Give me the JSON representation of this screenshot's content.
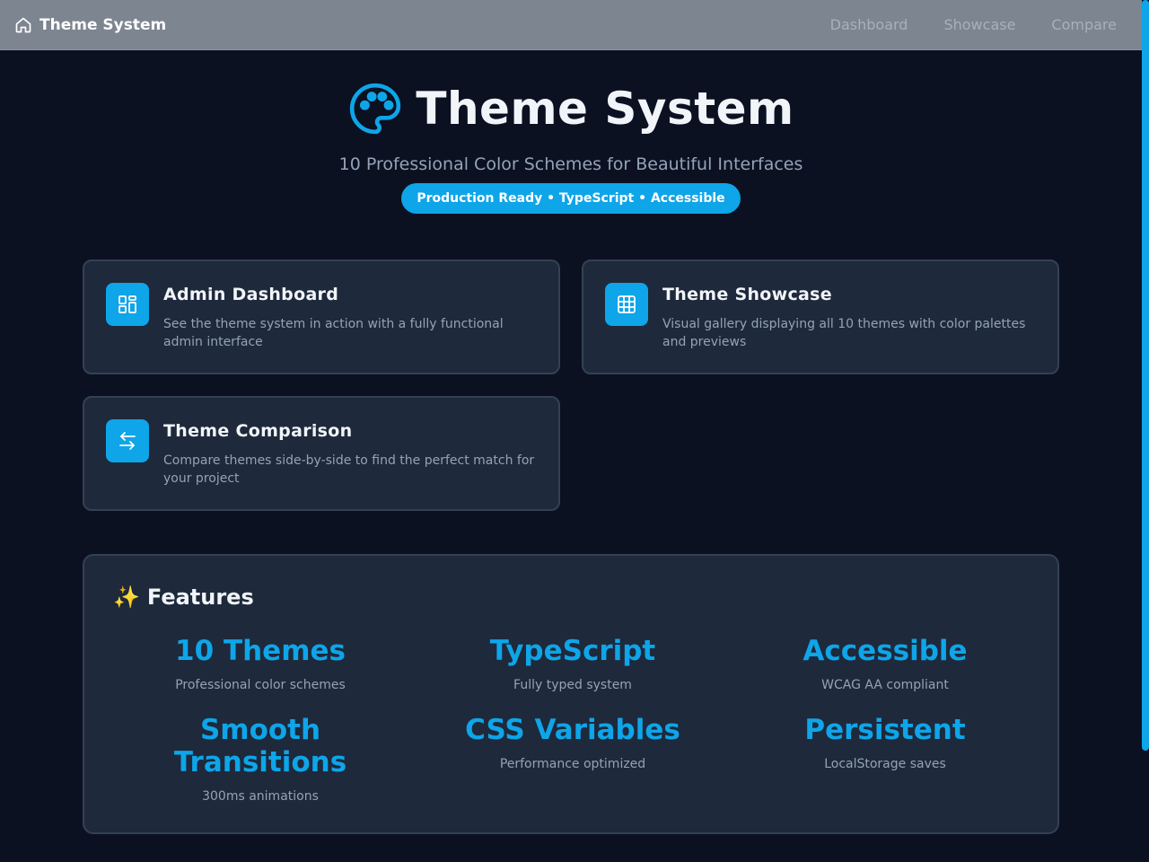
{
  "navbar": {
    "brand": "Theme System",
    "links": [
      "Dashboard",
      "Showcase",
      "Compare"
    ]
  },
  "hero": {
    "title": "Theme System",
    "subtitle": "10 Professional Color Schemes for Beautiful Interfaces",
    "badge": "Production Ready • TypeScript • Accessible"
  },
  "cards": [
    {
      "title": "Admin Dashboard",
      "description": "See the theme system in action with a fully functional admin interface",
      "icon": "dashboard-icon"
    },
    {
      "title": "Theme Showcase",
      "description": "Visual gallery displaying all 10 themes with color palettes and previews",
      "icon": "grid-icon"
    },
    {
      "title": "Theme Comparison",
      "description": "Compare themes side-by-side to find the perfect match for your project",
      "icon": "swap-arrows-icon"
    }
  ],
  "features": {
    "heading": "Features",
    "sparkle": "✨",
    "items": [
      {
        "title": "10 Themes",
        "description": "Professional color schemes"
      },
      {
        "title": "TypeScript",
        "description": "Fully typed system"
      },
      {
        "title": "Accessible",
        "description": "WCAG AA compliant"
      },
      {
        "title": "Smooth Transitions",
        "description": "300ms animations"
      },
      {
        "title": "CSS Variables",
        "description": "Performance optimized"
      },
      {
        "title": "Persistent",
        "description": "LocalStorage saves"
      }
    ]
  },
  "colors": {
    "background": "#0b1121",
    "surface": "#1e293b",
    "accent": "#0ea5e9",
    "text": "#f1f5f9",
    "muted": "#94a3b8"
  }
}
